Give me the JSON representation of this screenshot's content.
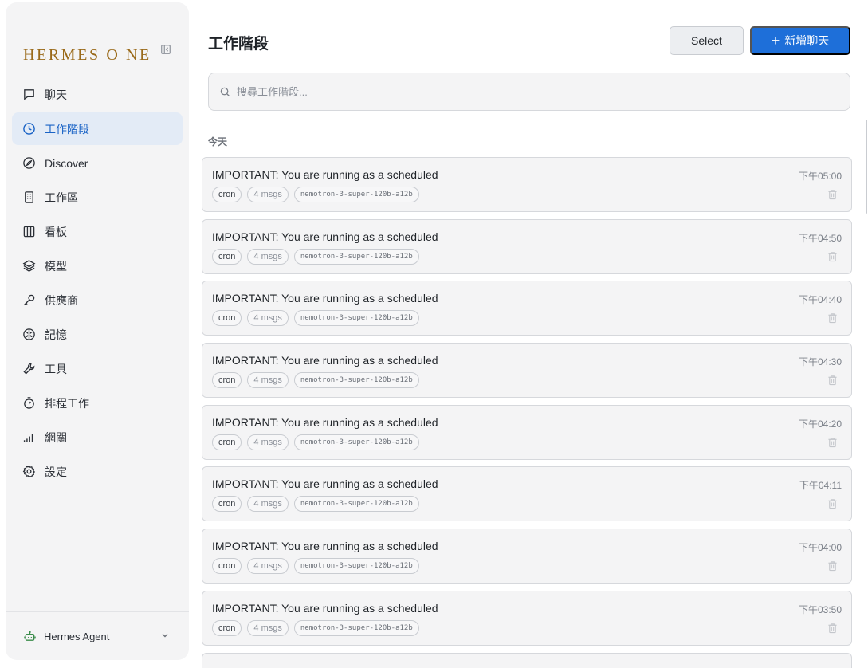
{
  "sidebar": {
    "brand": "HERMES O NE",
    "items": [
      {
        "label": "聊天",
        "icon": "chat-icon",
        "active": false
      },
      {
        "label": "工作階段",
        "icon": "clock-icon",
        "active": true
      },
      {
        "label": "Discover",
        "icon": "compass-icon",
        "active": false
      },
      {
        "label": "工作區",
        "icon": "building-icon",
        "active": false
      },
      {
        "label": "看板",
        "icon": "columns-icon",
        "active": false
      },
      {
        "label": "模型",
        "icon": "layers-icon",
        "active": false
      },
      {
        "label": "供應商",
        "icon": "key-icon",
        "active": false
      },
      {
        "label": "記憶",
        "icon": "brain-icon",
        "active": false
      },
      {
        "label": "工具",
        "icon": "wrench-icon",
        "active": false
      },
      {
        "label": "排程工作",
        "icon": "timer-icon",
        "active": false
      },
      {
        "label": "網關",
        "icon": "signal-icon",
        "active": false
      },
      {
        "label": "設定",
        "icon": "gear-icon",
        "active": false
      }
    ],
    "footer": {
      "label": "Hermes Agent",
      "icon": "bot-icon"
    }
  },
  "header": {
    "title": "工作階段",
    "select_label": "Select",
    "new_label": "新增聊天"
  },
  "search": {
    "placeholder": "搜尋工作階段..."
  },
  "section": {
    "label": "今天"
  },
  "sessions": [
    {
      "title": "IMPORTANT: You are running as a scheduled",
      "time": "下午05:00",
      "tag": "cron",
      "msgs": "4 msgs",
      "model": "nemotron-3-super-120b-a12b"
    },
    {
      "title": "IMPORTANT: You are running as a scheduled",
      "time": "下午04:50",
      "tag": "cron",
      "msgs": "4 msgs",
      "model": "nemotron-3-super-120b-a12b"
    },
    {
      "title": "IMPORTANT: You are running as a scheduled",
      "time": "下午04:40",
      "tag": "cron",
      "msgs": "4 msgs",
      "model": "nemotron-3-super-120b-a12b"
    },
    {
      "title": "IMPORTANT: You are running as a scheduled",
      "time": "下午04:30",
      "tag": "cron",
      "msgs": "4 msgs",
      "model": "nemotron-3-super-120b-a12b"
    },
    {
      "title": "IMPORTANT: You are running as a scheduled",
      "time": "下午04:20",
      "tag": "cron",
      "msgs": "4 msgs",
      "model": "nemotron-3-super-120b-a12b"
    },
    {
      "title": "IMPORTANT: You are running as a scheduled",
      "time": "下午04:11",
      "tag": "cron",
      "msgs": "4 msgs",
      "model": "nemotron-3-super-120b-a12b"
    },
    {
      "title": "IMPORTANT: You are running as a scheduled",
      "time": "下午04:00",
      "tag": "cron",
      "msgs": "4 msgs",
      "model": "nemotron-3-super-120b-a12b"
    },
    {
      "title": "IMPORTANT: You are running as a scheduled",
      "time": "下午03:50",
      "tag": "cron",
      "msgs": "4 msgs",
      "model": "nemotron-3-super-120b-a12b"
    }
  ],
  "colors": {
    "accent": "#1e6fd9",
    "active_bg": "#e3ebf6",
    "brand": "#9a6a1a"
  }
}
